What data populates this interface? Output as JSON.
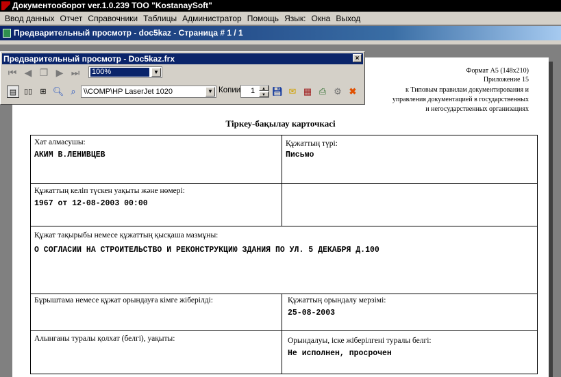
{
  "app": {
    "title": "Документооборот ver.1.0.239 ТОО \"KostanaySoft\""
  },
  "menu": [
    "Ввод данных",
    "Отчет",
    "Справочники",
    "Таблицы",
    "Администратор",
    "Помощь",
    "Язык:",
    "Окна",
    "Выход"
  ],
  "mdi": {
    "title": "Предварительный просмотр - doc5kaz - Страница # 1 / 1"
  },
  "toolbar": {
    "title": "Предварительный просмотр - Doc5kaz.frx",
    "close": "×",
    "zoom": "100%",
    "printer": "\\\\COMP\\HP LaserJet 1020",
    "copies_label": "Копии",
    "copies_value": "1"
  },
  "document": {
    "header_lines": [
      "Формат А5 (148х210)",
      "Приложение 15",
      "к Типовым правилам документирования и",
      "управления документацией в государственных",
      "и негосударственных организациях"
    ],
    "card_title": "Тіркеу-бақылау карточкасі",
    "fields": {
      "sender_label": "Хат алмасушы:",
      "sender_value": "АКИМ В.ЛЕНИВЦЕВ",
      "doc_type_label": "Құжаттың түрі:",
      "doc_type_value": "Письмо",
      "received_label": "Құжаттың келіп түскен уақыты және нөмері:",
      "received_value": "1967 от 12-08-2003 00:00",
      "subject_label": "Құжат тақырыбы немесе құжаттың қысқаша мазмұны:",
      "subject_value": "О СОГЛАСИИ НА СТРОИТЕЛЬСТВО И РЕКОНСТРУКЦИЮ ЗДАНИЯ ПО УЛ. 5 ДЕКАБРЯ  Д.100",
      "resolution_label": "Бұрыштама немесе құжат орындауға кімге жіберілді:",
      "deadline_label": "Құжаттың орындалу  мерзімі:",
      "deadline_value": "25-08-2003",
      "receipt_label": "Алынғаны туралы қолхат  (белгі), уақыты:",
      "execution_label": "Орындалуы, іске жіберілгені туралы  белгі:",
      "execution_value": "Не исполнен, просрочен"
    }
  }
}
